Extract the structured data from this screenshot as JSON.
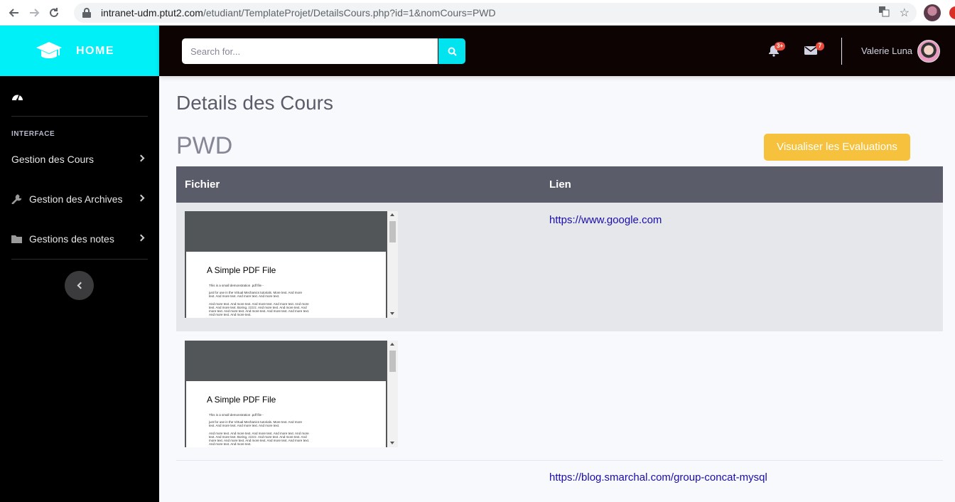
{
  "browser": {
    "url_host": "intranet-udm.ptut2.com",
    "url_path": "/etudiant/TemplateProjet/DetailsCours.php?id=1&nomCours=PWD"
  },
  "sidebar": {
    "brand": "HOME",
    "heading": "INTERFACE",
    "items": [
      {
        "label": "Gestion des Cours",
        "icon": "none"
      },
      {
        "label": "Gestion des Archives",
        "icon": "wrench-icon"
      },
      {
        "label": "Gestions des notes",
        "icon": "folder-icon"
      }
    ]
  },
  "topbar": {
    "search_placeholder": "Search for...",
    "alerts_count": "3+",
    "messages_count": "7",
    "user_name": "Valerie Luna"
  },
  "main": {
    "page_title": "Details des Cours",
    "course_code": "PWD",
    "eval_button": "Visualiser les Evaluations",
    "table": {
      "headers": {
        "file": "Fichier",
        "link": "Lien"
      },
      "rows": [
        {
          "pdf_title": "A Simple PDF File",
          "link": "https://www.google.com"
        },
        {
          "pdf_title": "A Simple PDF File",
          "link": ""
        },
        {
          "pdf_title": "",
          "link": "https://blog.smarchal.com/group-concat-mysql"
        }
      ]
    },
    "pdf_text": {
      "line1": "This is a small demonstration .pdf file -",
      "line2": "just for use in the Virtual Mechanics tutorials. More text. And more\ntext. And more text. And more text. And more text.",
      "line3": "And more text. And more text. And more text. And more text. And more\ntext. And more text. Boring, zzzzz. And more text. And more text. And\nmore text. And more text. And more text. And more text. And more text.\nAnd more text. And more text."
    }
  },
  "colors": {
    "brand": "#00f0f8",
    "topbar": "#0e0303",
    "sidebar": "#000000",
    "eval_button": "#f6c23e",
    "table_header": "#5a5c69",
    "link": "#1a0dab"
  }
}
